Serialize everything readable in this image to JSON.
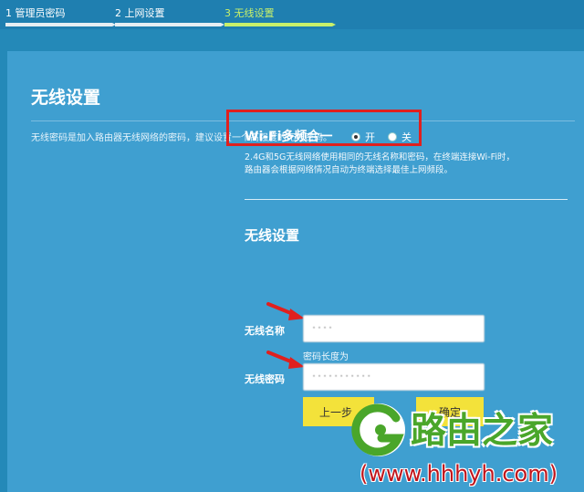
{
  "steps": [
    {
      "label": "1 管理员密码",
      "active": false
    },
    {
      "label": "2 上网设置",
      "active": false
    },
    {
      "label": "3 无线设置",
      "active": true
    }
  ],
  "page": {
    "title": "无线设置",
    "description": "无线密码是加入路由器无线网络的密码，建议设置一个高强度的无线密码。"
  },
  "wifi_multiband": {
    "title": "Wi-Fi多频合一",
    "options": [
      "开",
      "关"
    ],
    "selected": "开",
    "hint_line1": "2.4G和5G无线网络使用相同的无线名称和密码，在终端连接Wi-Fi时，",
    "hint_line2": "路由器会根据网络情况自动为终端选择最佳上网频段。"
  },
  "wireless": {
    "section_title": "无线设置",
    "name_label": "无线名称",
    "name_value": "····",
    "password_label": "无线密码",
    "password_value": "···········",
    "password_hint": "密码长度为                                       "
  },
  "buttons": {
    "prev": "上一步",
    "next": "确定"
  },
  "watermark": {
    "brand": "路由之家",
    "url": "(www.hhhyh.com)"
  },
  "colors": {
    "background": "#2489b8",
    "panel": "#3f9fd0",
    "accent": "#c8f06a",
    "button": "#f3e23a",
    "highlight": "#e0201e"
  }
}
